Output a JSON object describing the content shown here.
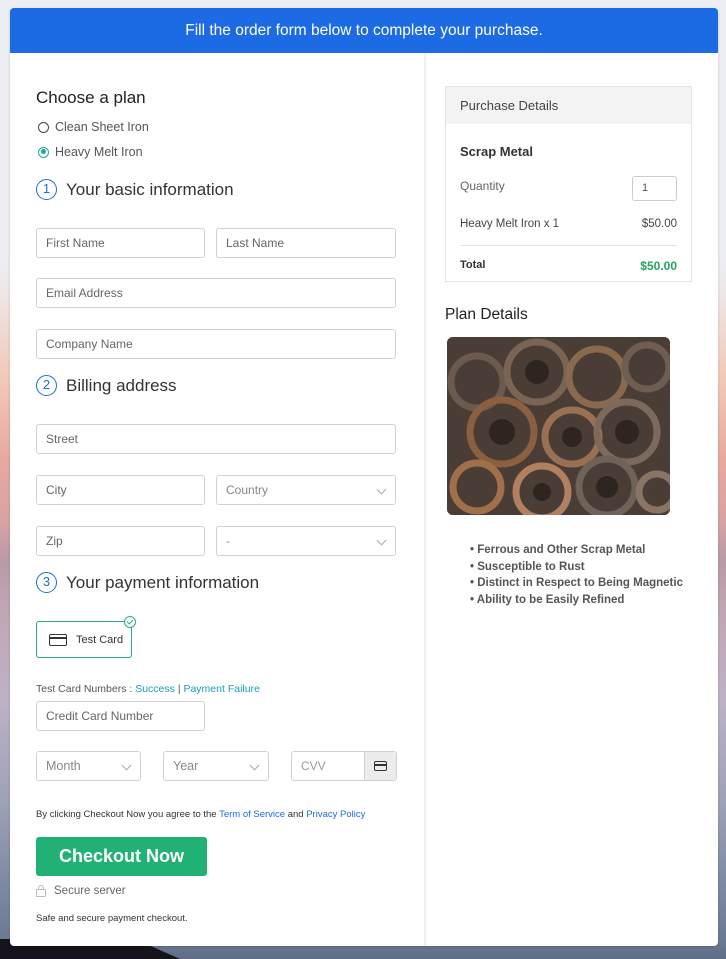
{
  "banner": {
    "text": "Fill the order form below to complete your purchase."
  },
  "plan": {
    "heading": "Choose a plan",
    "options": [
      {
        "label": "Clean Sheet Iron",
        "selected": false
      },
      {
        "label": "Heavy Melt Iron",
        "selected": true
      }
    ]
  },
  "steps": [
    {
      "number": "1",
      "title": "Your basic information"
    },
    {
      "number": "2",
      "title": "Billing address"
    },
    {
      "number": "3",
      "title": "Your payment information"
    }
  ],
  "basic": {
    "first_name": "First Name",
    "last_name": "Last Name",
    "email": "Email Address",
    "company": "Company Name"
  },
  "billing": {
    "street": "Street",
    "city": "City",
    "country": "Country",
    "zip": "Zip",
    "state": "-"
  },
  "payment": {
    "method_label": "Test Card",
    "test_numbers_label": "Test Card Numbers :",
    "success_link": "Success",
    "separator": "|",
    "failure_link": "Payment Failure",
    "card_number": "Credit Card Number",
    "month": "Month",
    "year": "Year",
    "cvv": "CVV"
  },
  "agreement": {
    "prefix": "By clicking Checkout Now you agree to the",
    "tos": "Term of Service",
    "and": "and",
    "privacy": "Privacy Policy"
  },
  "checkout": {
    "button": "Checkout Now",
    "secure": "Secure server",
    "safe": "Safe and secure payment checkout."
  },
  "purchase": {
    "heading": "Purchase Details",
    "product": "Scrap Metal",
    "quantity_label": "Quantity",
    "quantity": "1",
    "line_item": "Heavy Melt Iron x 1",
    "line_price": "$50.00",
    "total_label": "Total",
    "total": "$50.00"
  },
  "plan_details": {
    "heading": "Plan Details",
    "image_alt": "Pile of rusty scrap metal brake drums",
    "features": [
      "Ferrous and Other Scrap Metal",
      "Susceptible to Rust",
      "Distinct in Respect to Being Magnetic",
      "Ability to be Easily Refined"
    ]
  },
  "colors": {
    "primary": "#1d6ae5",
    "success": "#21b175",
    "total_green": "#21a65a",
    "link_teal": "#17a2b8"
  }
}
